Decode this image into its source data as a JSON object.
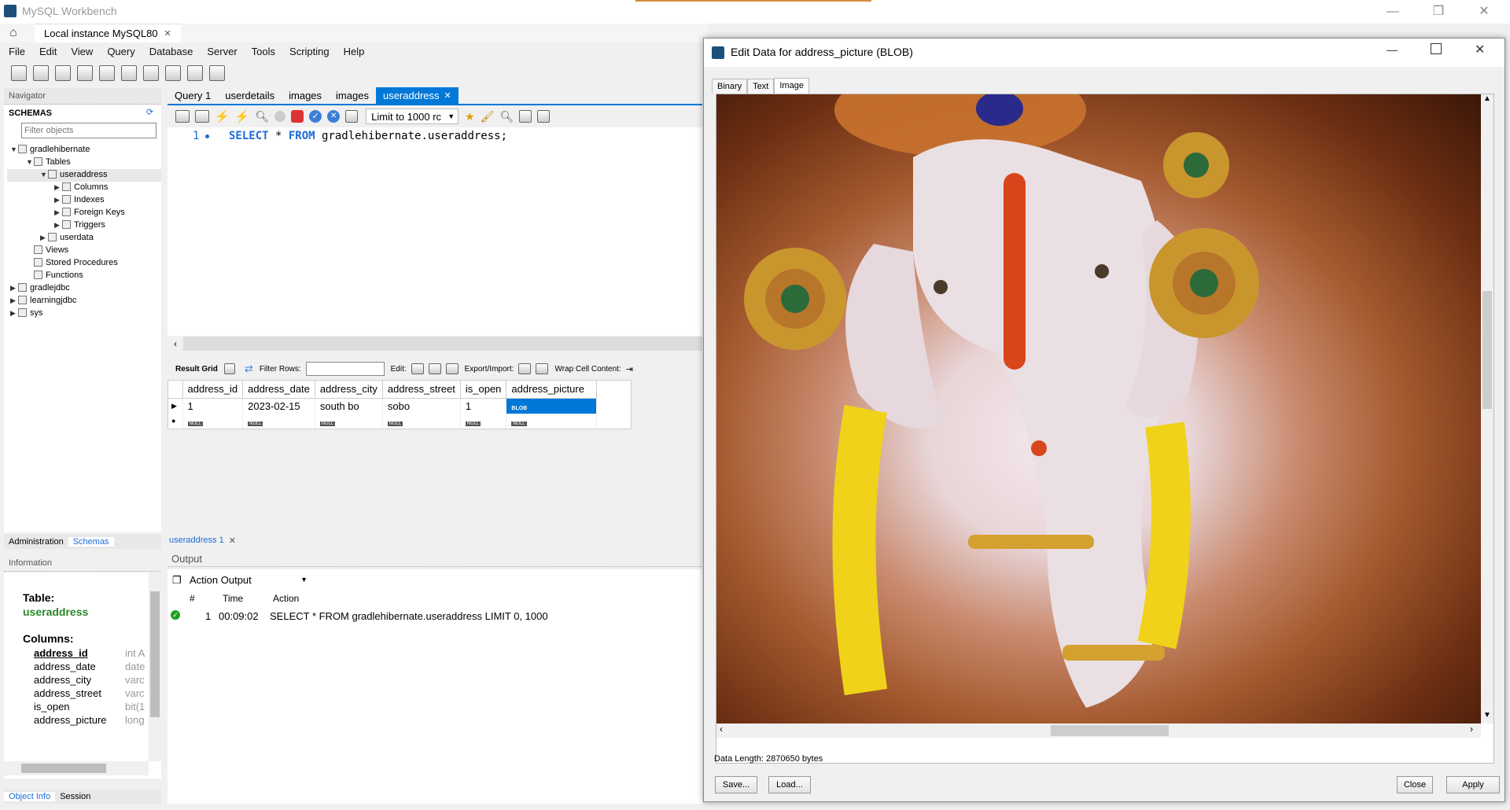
{
  "app": {
    "title": "MySQL Workbench",
    "connection_tab": "Local instance MySQL80"
  },
  "menu": [
    "File",
    "Edit",
    "View",
    "Query",
    "Database",
    "Server",
    "Tools",
    "Scripting",
    "Help"
  ],
  "navigator": {
    "header": "Navigator",
    "schemas_label": "SCHEMAS",
    "filter_placeholder": "Filter objects",
    "tree": {
      "db1": "gradlehibernate",
      "tables": "Tables",
      "useraddress": "useraddress",
      "columns": "Columns",
      "indexes": "Indexes",
      "foreign_keys": "Foreign Keys",
      "triggers": "Triggers",
      "userdata": "userdata",
      "views": "Views",
      "stored_procedures": "Stored Procedures",
      "functions": "Functions",
      "db2": "gradlejdbc",
      "db3": "learningjdbc",
      "db4": "sys"
    },
    "bottom_tabs": [
      "Administration",
      "Schemas"
    ]
  },
  "editor": {
    "tabs": [
      "Query 1",
      "userdetails",
      "images",
      "images",
      "useraddress"
    ],
    "limit_label": "Limit to 1000 rc",
    "line_number": "1",
    "sql": {
      "kw1": "SELECT",
      "star": " * ",
      "kw2": "FROM",
      "rest": " gradlehibernate.useraddress;"
    }
  },
  "result": {
    "result_grid_label": "Result Grid",
    "filter_rows_label": "Filter Rows:",
    "edit_label": "Edit:",
    "export_label": "Export/Import:",
    "wrap_label": "Wrap Cell Content:",
    "columns": [
      "address_id",
      "address_date",
      "address_city",
      "address_street",
      "is_open",
      "address_picture"
    ],
    "row": [
      "1",
      "2023-02-15",
      "south bo",
      "sobo",
      "1",
      "BLOB"
    ],
    "null_text": "NULL",
    "result_tab": "useraddress 1"
  },
  "output": {
    "header": "Output",
    "selector": "Action Output",
    "columns": [
      "#",
      "Time",
      "Action"
    ],
    "row": {
      "num": "1",
      "time": "00:09:02",
      "action": "SELECT * FROM gradlehibernate.useraddress LIMIT 0, 1000"
    }
  },
  "information": {
    "header": "Information",
    "table_label": "Table:",
    "table_name": "useraddress",
    "columns_label": "Columns:",
    "columns": [
      {
        "name": "address_id",
        "type": "int A"
      },
      {
        "name": "address_date",
        "type": "date"
      },
      {
        "name": "address_city",
        "type": "varc"
      },
      {
        "name": "address_street",
        "type": "varc"
      },
      {
        "name": "is_open",
        "type": "bit(1"
      },
      {
        "name": "address_picture",
        "type": "long"
      }
    ],
    "bottom_tabs": [
      "Object Info",
      "Session"
    ]
  },
  "dialog": {
    "title": "Edit Data for address_picture (BLOB)",
    "tabs": [
      "Binary",
      "Text",
      "Image"
    ],
    "data_length": "Data Length: 2870650 bytes",
    "buttons": {
      "save": "Save...",
      "load": "Load...",
      "close": "Close",
      "apply": "Apply"
    }
  },
  "colors": {
    "accent": "#0078d7",
    "brand": "#1d4f7c",
    "ok_green": "#1ea21e"
  }
}
